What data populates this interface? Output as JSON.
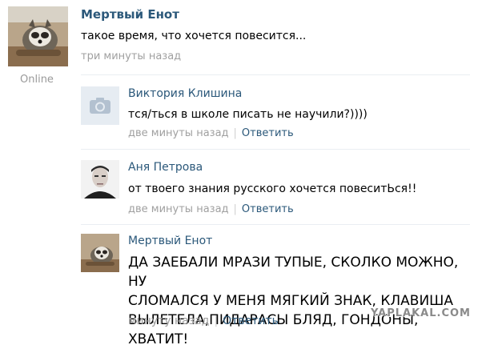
{
  "post": {
    "author": "Мертвый Енот",
    "text": "такое время, что хочется повесится...",
    "time": "три минуты назад",
    "status": "Online"
  },
  "comments": [
    {
      "author": "Виктория Клишина",
      "text": "тся/ться в школе писать не научили?))))",
      "time": "две минуты назад",
      "reply": "Ответить",
      "avatar": "camera-icon"
    },
    {
      "author": "Аня Петрова",
      "text": "от твоего знания русского хочется повеситЬся!!",
      "time": "две минуты назад",
      "reply": "Ответить",
      "avatar": "person-photo"
    },
    {
      "author": "Мертвый Енот",
      "lines": [
        "ДА ЗАЕБАЛИ МРАЗИ ТУПЫЕ, СКОЛКО МОЖНО, НУ",
        "СЛОМАЛСЯ У МЕНЯ МЯГКИЙ ЗНАК, КЛАВИША",
        "ВЫЛЕТЕЛА,ПИДАРАСЫ БЛЯД, ГОНДОНЫ, ХВАТИТ!"
      ],
      "time": "минуту назад",
      "reply": "Ответить",
      "avatar": "raccoon-photo"
    }
  ],
  "watermark": "YAPLAKAL.COM",
  "colors": {
    "link": "#2b587a",
    "muted": "#a0a0a0"
  }
}
